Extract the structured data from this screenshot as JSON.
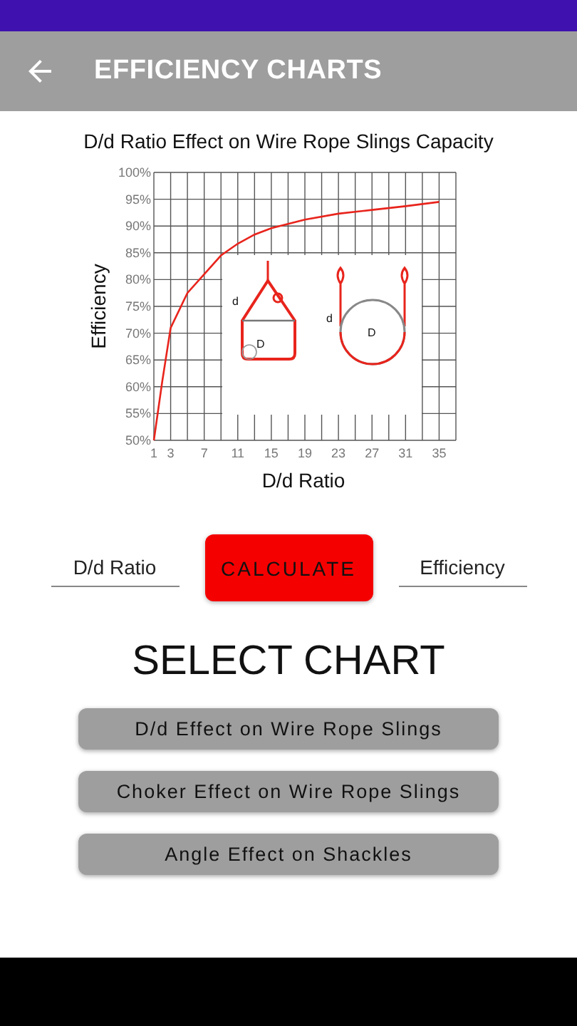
{
  "app_bar": {
    "title": "EFFICIENCY CHARTS"
  },
  "chart": {
    "chart_data": {
      "type": "line",
      "title": "D/d Ratio Effect on Wire Rope Slings Capacity",
      "xlabel": "D/d Ratio",
      "ylabel": "Efficiency",
      "xlim": [
        1,
        37
      ],
      "ylim": [
        50,
        100
      ],
      "xticks": [
        1,
        3,
        7,
        11,
        15,
        19,
        23,
        27,
        31,
        35
      ],
      "yticks": [
        {
          "value": 50,
          "label": "50%"
        },
        {
          "value": 55,
          "label": "55%"
        },
        {
          "value": 60,
          "label": "60%"
        },
        {
          "value": 65,
          "label": "65%"
        },
        {
          "value": 70,
          "label": "70%"
        },
        {
          "value": 75,
          "label": "75%"
        },
        {
          "value": 80,
          "label": "80%"
        },
        {
          "value": 85,
          "label": "85%"
        },
        {
          "value": 90,
          "label": "90%"
        },
        {
          "value": 95,
          "label": "95%"
        },
        {
          "value": 100,
          "label": "100%"
        }
      ],
      "x": [
        1,
        2,
        3,
        5,
        7,
        9,
        11,
        13,
        15,
        19,
        23,
        27,
        31,
        35
      ],
      "grid": true,
      "series": [
        {
          "color": "#e8241c",
          "values": [
            50,
            61,
            71,
            77.5,
            81,
            84.5,
            86.7,
            88.4,
            89.6,
            91.2,
            92.3,
            93,
            93.7,
            94.5
          ]
        }
      ],
      "annotations": [
        {
          "text": "d"
        },
        {
          "text": "D"
        },
        {
          "text": "d"
        },
        {
          "text": "D"
        }
      ]
    }
  },
  "inputs": [
    {
      "placeholder": "D/d Ratio"
    },
    {
      "placeholder": "Efficiency"
    }
  ],
  "calculate_button": "CALCULATE",
  "section_title": "SELECT CHART",
  "chart_buttons": [
    "D/d Effect on Wire Rope Slings",
    "Choker Effect on Wire Rope Slings",
    "Angle Effect on Shackles"
  ]
}
